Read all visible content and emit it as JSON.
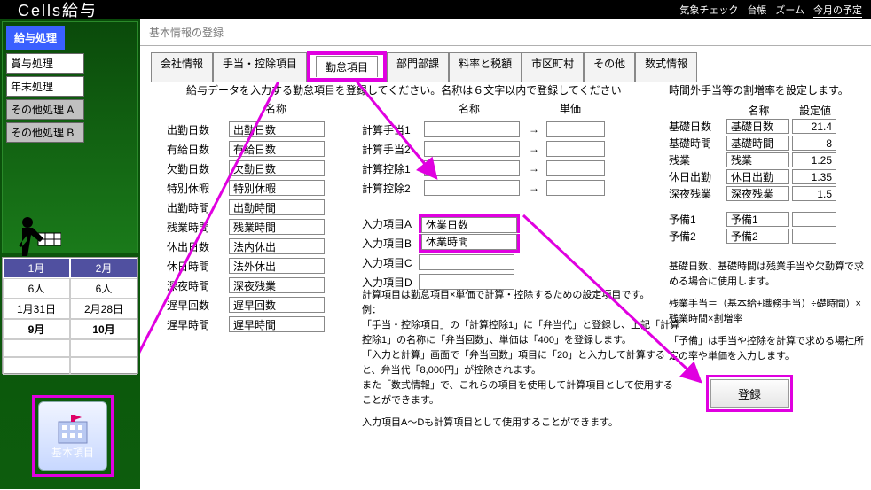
{
  "app": {
    "brand": "Cells給与"
  },
  "topbar_right": [
    "気象チェック",
    "台帳",
    "ズーム",
    "今月の予定"
  ],
  "sidebar": {
    "main": "給与処理",
    "items": [
      "賞与処理",
      "年末処理",
      "その他処理 A",
      "その他処理 B"
    ]
  },
  "calendar": {
    "months": [
      "1月",
      "2月"
    ],
    "rows": [
      [
        "6人",
        "6人"
      ],
      [
        "1月31日",
        "2月28日"
      ],
      [
        "9月",
        "10月"
      ]
    ]
  },
  "base_button": "基本項目",
  "page_title": "基本情報の登録",
  "tabs": [
    "会社情報",
    "手当・控除項目",
    "勤怠項目",
    "部門部課",
    "料率と税額",
    "市区町村",
    "その他",
    "数式情報"
  ],
  "active_tab_index": 2,
  "instruction": "給与データを入力する勤怠項目を登録してください。名称は６文字以内で登録してください",
  "col1": {
    "head": "名称",
    "rows": [
      {
        "label": "出勤日数",
        "value": "出勤日数"
      },
      {
        "label": "有給日数",
        "value": "有給日数"
      },
      {
        "label": "欠勤日数",
        "value": "欠勤日数"
      },
      {
        "label": "特別休暇",
        "value": "特別休暇"
      },
      {
        "label": "出勤時間",
        "value": "出勤時間"
      },
      {
        "label": "残業時間",
        "value": "残業時間"
      },
      {
        "label": "休出日数",
        "value": "法内休出"
      },
      {
        "label": "休日時間",
        "value": "法外休出"
      },
      {
        "label": "深夜時間",
        "value": "深夜残業"
      },
      {
        "label": "遅早回数",
        "value": "遅早回数"
      },
      {
        "label": "遅早時間",
        "value": "遅早時間"
      }
    ]
  },
  "col2": {
    "head_name": "名称",
    "head_unit": "単価",
    "calc_rows": [
      {
        "label": "計算手当1",
        "value": "",
        "arrow": "→"
      },
      {
        "label": "計算手当2",
        "value": "",
        "arrow": "→"
      },
      {
        "label": "計算控除1",
        "value": "",
        "arrow": "→"
      },
      {
        "label": "計算控除2",
        "value": "",
        "arrow": "→"
      }
    ],
    "input_rows": [
      {
        "label": "入力項目A",
        "value": "休業日数"
      },
      {
        "label": "入力項目B",
        "value": "休業時間"
      },
      {
        "label": "入力項目C",
        "value": ""
      },
      {
        "label": "入力項目D",
        "value": ""
      }
    ]
  },
  "calc_note": {
    "l1": "計算項目は勤怠項目×単価で計算・控除するための設定項目です。",
    "l2": "例：",
    "l3": "「手当・控除項目」の「計算控除1」に「弁当代」と登録し、上記「計算控除1」の名称に「弁当回数」、単価は「400」を登録します。",
    "l4": "「入力と計算」画面で「弁当回数」項目に「20」と入力して計算すると、弁当代「8,000円」が控除されます。",
    "l5": "また「数式情報」で、これらの項目を使用して計算項目として使用することができます。",
    "l6": "入力項目A～Dも計算項目として使用することができます。"
  },
  "col3": {
    "title": "時間外手当等の割増率を設定します。",
    "head_name": "名称",
    "head_val": "設定値",
    "rows": [
      {
        "label": "基礎日数",
        "name": "基礎日数",
        "value": "21.4"
      },
      {
        "label": "基礎時間",
        "name": "基礎時間",
        "value": "8"
      },
      {
        "label": "残業",
        "name": "残業",
        "value": "1.25"
      },
      {
        "label": "休日出勤",
        "name": "休日出勤",
        "value": "1.35"
      },
      {
        "label": "深夜残業",
        "name": "深夜残業",
        "value": "1.5"
      }
    ],
    "spare": [
      {
        "label": "予備1",
        "name": "予備1",
        "value": ""
      },
      {
        "label": "予備2",
        "name": "予備2",
        "value": ""
      }
    ]
  },
  "rate_note": {
    "l1": "基礎日数、基礎時間は残業手当や欠勤算で求める場合に使用します。",
    "l2": "残業手当＝（基本給+職務手当）÷礎時間）×残業時間×割増率",
    "l3": "「予備」は手当や控除を計算で求める場社所定の率や単価を入力します。"
  },
  "register_label": "登録"
}
